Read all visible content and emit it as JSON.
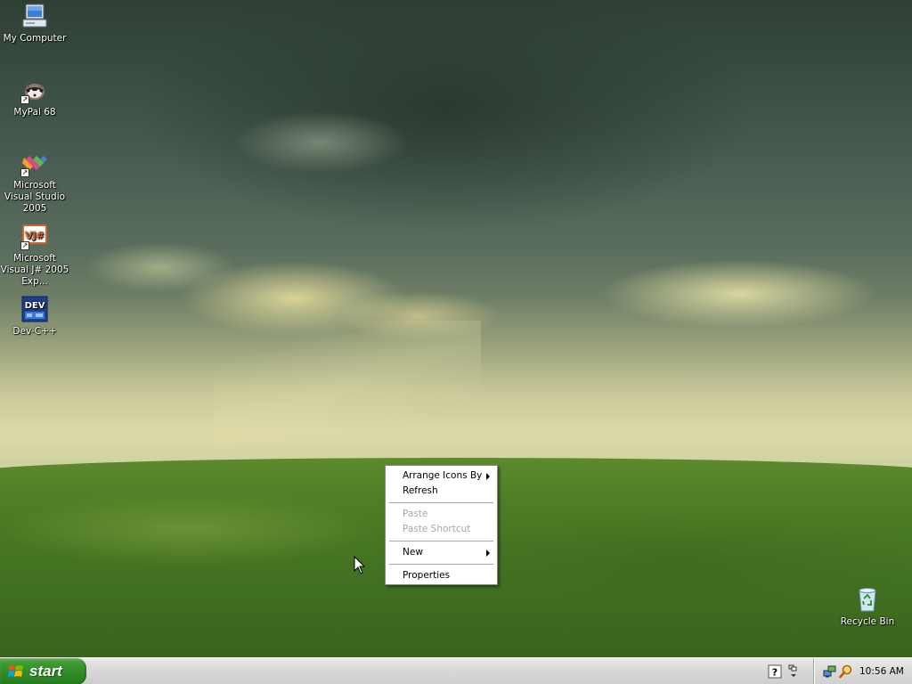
{
  "desktop": {
    "icons": [
      {
        "label": "My Computer",
        "icon": "my-computer-icon"
      },
      {
        "label": "MyPal 68",
        "icon": "mypal-icon",
        "shortcut": true
      },
      {
        "label": "Microsoft Visual Studio 2005",
        "icon": "visual-studio-icon",
        "shortcut": true
      },
      {
        "label": "Microsoft Visual J# 2005 Exp...",
        "icon": "visual-jsharp-icon",
        "shortcut": true
      },
      {
        "label": "Dev-C++",
        "icon": "dev-cpp-icon"
      },
      {
        "label": "Recycle Bin",
        "icon": "recycle-bin-icon"
      }
    ],
    "shortcut_arrow": "↗"
  },
  "context_menu": {
    "items": [
      {
        "label": "Arrange Icons By",
        "submenu": true,
        "enabled": true
      },
      {
        "label": "Refresh",
        "enabled": true
      },
      {
        "label": "Paste",
        "enabled": false
      },
      {
        "label": "Paste Shortcut",
        "enabled": false
      },
      {
        "label": "New",
        "submenu": true,
        "enabled": true
      },
      {
        "label": "Properties",
        "enabled": true
      }
    ]
  },
  "taskbar": {
    "start_label": "start",
    "clock": "10:56 AM",
    "tray_icons": [
      "help-icon",
      "network-icon",
      "search-icon"
    ]
  },
  "colors": {
    "start_green": "#3c9a32",
    "taskbar_silver": "#d8d8d8",
    "menu_disabled": "#a7a7a7"
  }
}
